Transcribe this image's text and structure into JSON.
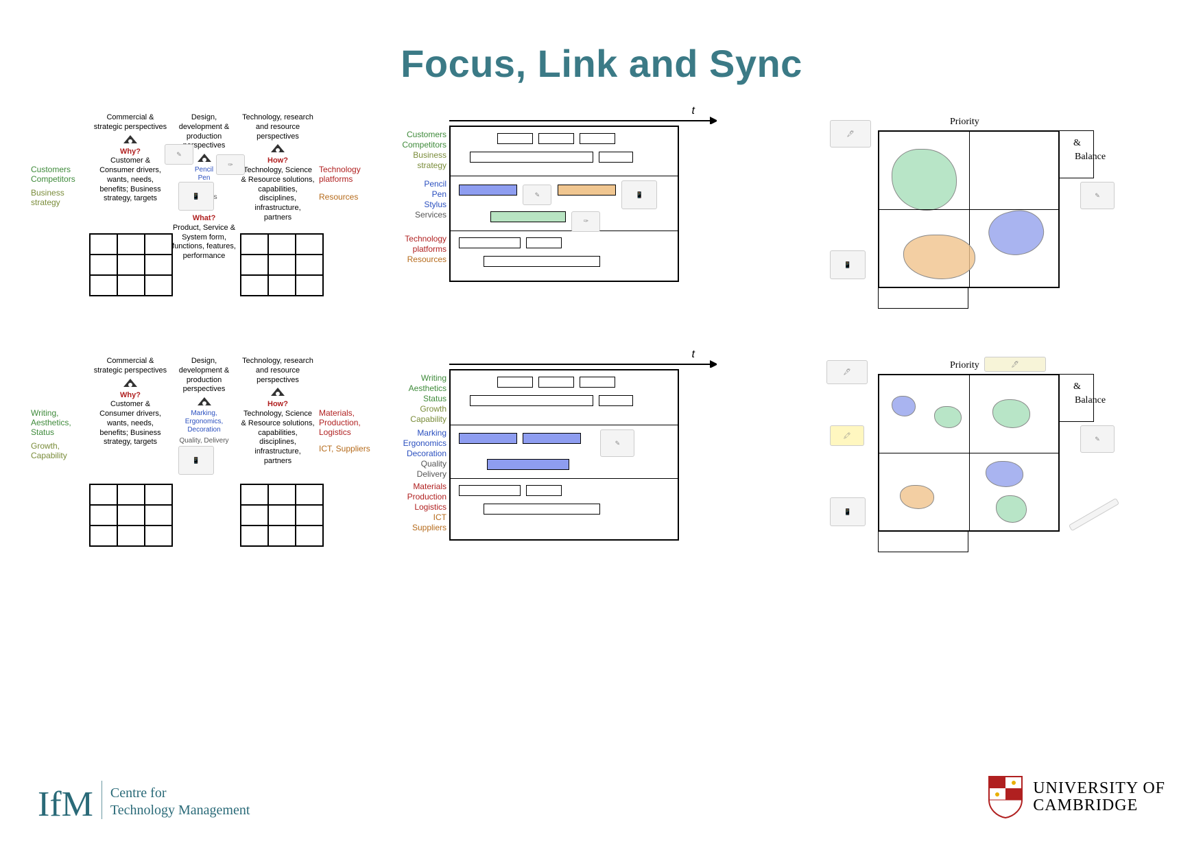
{
  "title": "Focus, Link and Sync",
  "perspectives": {
    "commercial": "Commercial & strategic perspectives",
    "design": "Design, development & production perspectives",
    "tech": "Technology, research and resource perspectives"
  },
  "why": {
    "heading": "Why?",
    "body": "Customer & Consumer drivers, wants, needs, benefits; Business strategy, targets"
  },
  "how": {
    "heading": "How?",
    "body": "Technology, Science & Resource solutions, capabilities, disciplines, infrastructure, partners"
  },
  "what": {
    "heading": "What?",
    "body": "Product, Service & System form, functions, features, performance"
  },
  "row1": {
    "left_labels": [
      {
        "text": "Customers",
        "cls": "green"
      },
      {
        "text": "Competitors",
        "cls": "green"
      },
      {
        "text": "",
        "cls": ""
      },
      {
        "text": "Business strategy",
        "cls": "olive"
      }
    ],
    "prod_labels": [
      {
        "text": "Pencil",
        "cls": "blue"
      },
      {
        "text": "Pen",
        "cls": "blue"
      },
      {
        "text": "Stylus",
        "cls": "blue"
      },
      {
        "text": "Services",
        "cls": "grey"
      }
    ],
    "right_labels": [
      {
        "text": "Technology platforms",
        "cls": "red"
      },
      {
        "text": "",
        "cls": ""
      },
      {
        "text": "Resources",
        "cls": "dorange"
      }
    ],
    "roadmap": {
      "time_label": "t",
      "band1": [
        {
          "text": "Customers",
          "cls": "green"
        },
        {
          "text": "Competitors",
          "cls": "green"
        },
        {
          "text": "Business strategy",
          "cls": "olive"
        }
      ],
      "band2": [
        {
          "text": "Pencil",
          "cls": "blue"
        },
        {
          "text": "Pen",
          "cls": "blue"
        },
        {
          "text": "Stylus",
          "cls": "blue"
        },
        {
          "text": "Services",
          "cls": "grey"
        }
      ],
      "band3": [
        {
          "text": "Technology platforms",
          "cls": "red"
        },
        {
          "text": "Resources",
          "cls": "dorange"
        }
      ]
    },
    "quadrant": {
      "priority": "Priority",
      "and": "&",
      "balance": "Balance"
    }
  },
  "row2": {
    "left_labels": [
      {
        "text": "Writing, Aesthetics, Status",
        "cls": "green"
      },
      {
        "text": "",
        "cls": ""
      },
      {
        "text": "Growth, Capability",
        "cls": "olive"
      }
    ],
    "prod_labels": [
      {
        "text": "Marking, Ergonomics, Decoration",
        "cls": "blue"
      },
      {
        "text": "Quality, Delivery",
        "cls": "grey"
      }
    ],
    "right_labels": [
      {
        "text": "Materials, Production, Logistics",
        "cls": "red"
      },
      {
        "text": "",
        "cls": ""
      },
      {
        "text": "ICT, Suppliers",
        "cls": "dorange"
      }
    ],
    "roadmap": {
      "time_label": "t",
      "band1": [
        {
          "text": "Writing",
          "cls": "green"
        },
        {
          "text": "Aesthetics",
          "cls": "green"
        },
        {
          "text": "Status",
          "cls": "green"
        },
        {
          "text": "Growth",
          "cls": "olive"
        },
        {
          "text": "Capability",
          "cls": "olive"
        }
      ],
      "band2": [
        {
          "text": "Marking",
          "cls": "blue"
        },
        {
          "text": "Ergonomics",
          "cls": "blue"
        },
        {
          "text": "Decoration",
          "cls": "blue"
        },
        {
          "text": "Quality",
          "cls": "grey"
        },
        {
          "text": "Delivery",
          "cls": "grey"
        }
      ],
      "band3": [
        {
          "text": "Materials",
          "cls": "red"
        },
        {
          "text": "Production",
          "cls": "red"
        },
        {
          "text": "Logistics",
          "cls": "red"
        },
        {
          "text": "ICT",
          "cls": "dorange"
        },
        {
          "text": "Suppliers",
          "cls": "dorange"
        }
      ]
    },
    "quadrant": {
      "priority": "Priority",
      "and": "&",
      "balance": "Balance"
    }
  },
  "footer": {
    "ifm_logo": "IfM",
    "ifm_line1": "Centre for",
    "ifm_line2": "Technology Management",
    "camb_line1": "UNIVERSITY OF",
    "camb_line2": "CAMBRIDGE"
  }
}
